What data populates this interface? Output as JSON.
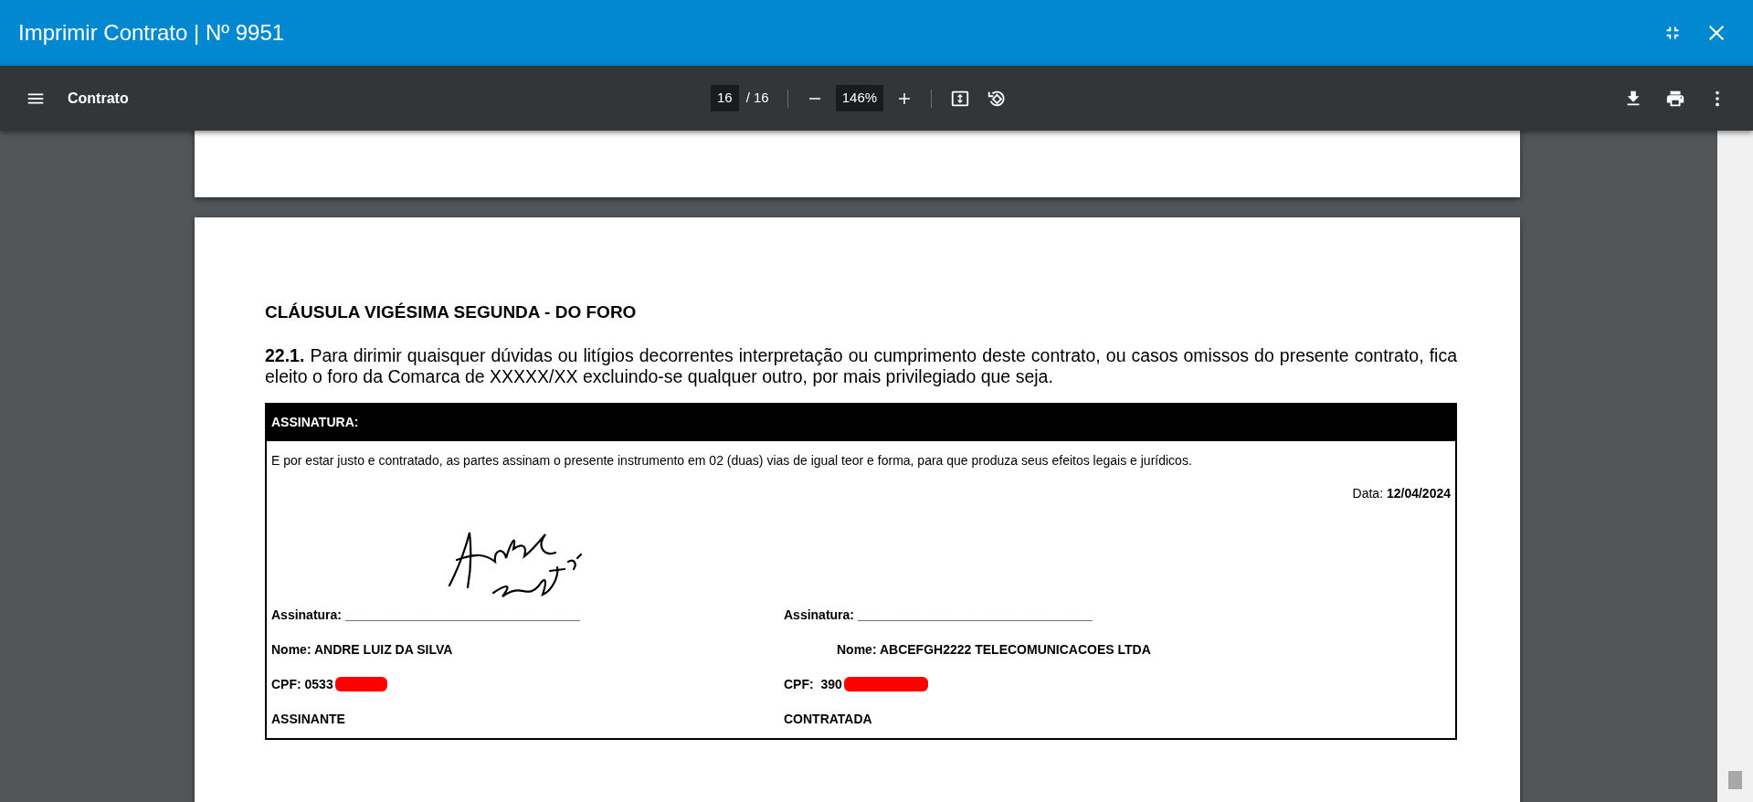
{
  "window": {
    "title": "Imprimir Contrato | Nº 9951"
  },
  "toolbar": {
    "document_title": "Contrato",
    "current_page": "16",
    "page_total": "/ 16",
    "zoom": "146%"
  },
  "document": {
    "heading": "CLÁUSULA VIGÉSIMA SEGUNDA - DO FORO",
    "paragraph": "**22.1.** Para dirimir quaisquer dúvidas ou litígios decorrentes interpretação ou cumprimento deste contrato, ou casos omissos do presente contrato, fica eleito o foro da Comarca de XXXXX/XX excluindo-se qualquer outro, por mais privilegiado que seja.",
    "signature_table": {
      "header": "ASSINATURA:",
      "statement": "E por estar justo e contratado, as partes assinam o presente instrumento em 02 (duas) vias de igual teor e forma, para que produza seus efeitos legais e jurídicos.",
      "date": "Data: **12/04/2024**",
      "parties": [
        {
          "signature_line": "Assinatura: _________________________________",
          "name": "Nome: ANDRE LUIZ DA SILVA",
          "cpf": "CPF: 0533",
          "role": "ASSINANTE",
          "signed": true
        },
        {
          "signature_line": "Assinatura: _________________________________",
          "name": "Nome: ABCEFGH2222 TELECOMUNICACOES LTDA",
          "cpf": "CPF:  390",
          "role": "CONTRATADA",
          "signed": false
        }
      ]
    }
  }
}
